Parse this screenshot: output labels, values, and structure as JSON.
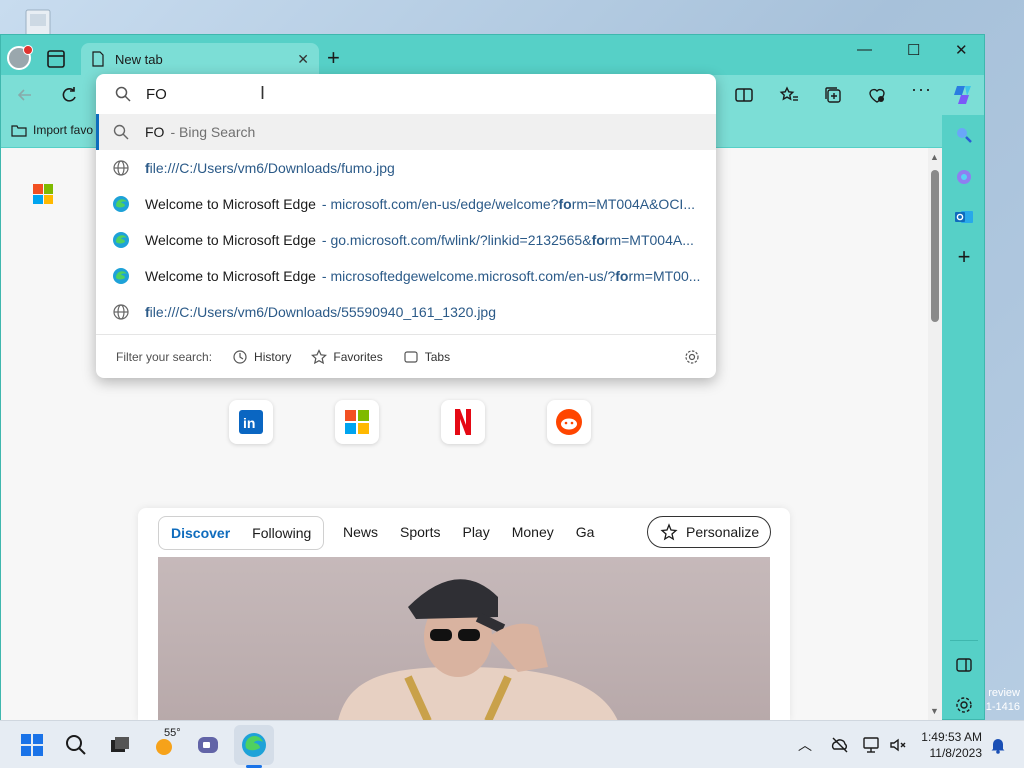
{
  "browser": {
    "tab_title": "New tab",
    "favorites_bar": {
      "import_label": "Import favo"
    }
  },
  "omnibox": {
    "value": "FO",
    "suggestions": [
      {
        "kind": "search",
        "match": "FO",
        "rest": "",
        "sub": "- Bing Search"
      },
      {
        "kind": "file",
        "match": "f",
        "rest": "ile:///C:/Users/vm6/Downloads/fumo.jpg",
        "sub": ""
      },
      {
        "kind": "edge",
        "title": "Welcome to Microsoft Edge",
        "sub_pre": "- microsoft.com/en-us/edge/welcome?",
        "sub_match": "fo",
        "sub_post": "rm=MT004A&OCI..."
      },
      {
        "kind": "edge",
        "title": "Welcome to Microsoft Edge",
        "sub_pre": "- go.microsoft.com/fwlink/?linkid=2132565&",
        "sub_match": "fo",
        "sub_post": "rm=MT004A..."
      },
      {
        "kind": "edge",
        "title": "Welcome to Microsoft Edge",
        "sub_pre": "- microsoftedgewelcome.microsoft.com/en-us/?",
        "sub_match": "fo",
        "sub_post": "rm=MT00..."
      },
      {
        "kind": "file",
        "match": "f",
        "rest": "ile:///C:/Users/vm6/Downloads/55590940_161_1320.jpg",
        "sub": ""
      }
    ],
    "filter": {
      "label": "Filter your search:",
      "history": "History",
      "favorites": "Favorites",
      "tabs": "Tabs"
    }
  },
  "feed": {
    "tabs": [
      "Discover",
      "Following"
    ],
    "nav": [
      "News",
      "Sports",
      "Play",
      "Money",
      "Ga"
    ],
    "personalize": "Personalize"
  },
  "taskbar": {
    "weather": "55°",
    "time": "1:49:53 AM",
    "date": "11/8/2023"
  },
  "watermark": {
    "line1": "review",
    "line2": "1-1416"
  },
  "colors": {
    "accent": "#56d0c7",
    "link": "#2b5a88",
    "selected_border": "#0f6cbd"
  }
}
